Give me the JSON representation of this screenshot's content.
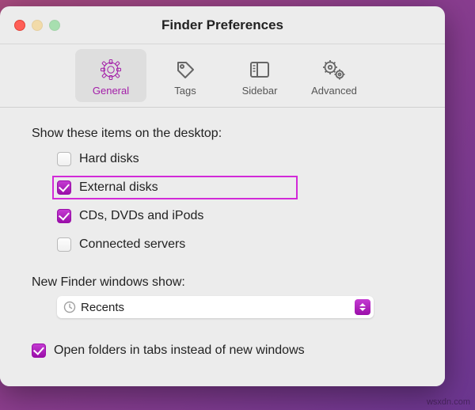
{
  "window": {
    "title": "Finder Preferences"
  },
  "toolbar": {
    "general": "General",
    "tags": "Tags",
    "sidebar": "Sidebar",
    "advanced": "Advanced"
  },
  "desktopSection": {
    "label": "Show these items on the desktop:",
    "items": [
      {
        "label": "Hard disks",
        "checked": false
      },
      {
        "label": "External disks",
        "checked": true
      },
      {
        "label": "CDs, DVDs and iPods",
        "checked": true
      },
      {
        "label": "Connected servers",
        "checked": false
      }
    ]
  },
  "newWindows": {
    "label": "New Finder windows show:",
    "value": "Recents"
  },
  "openInTabs": {
    "label": "Open folders in tabs instead of new windows",
    "checked": true
  },
  "watermark": "wsxdn.com"
}
